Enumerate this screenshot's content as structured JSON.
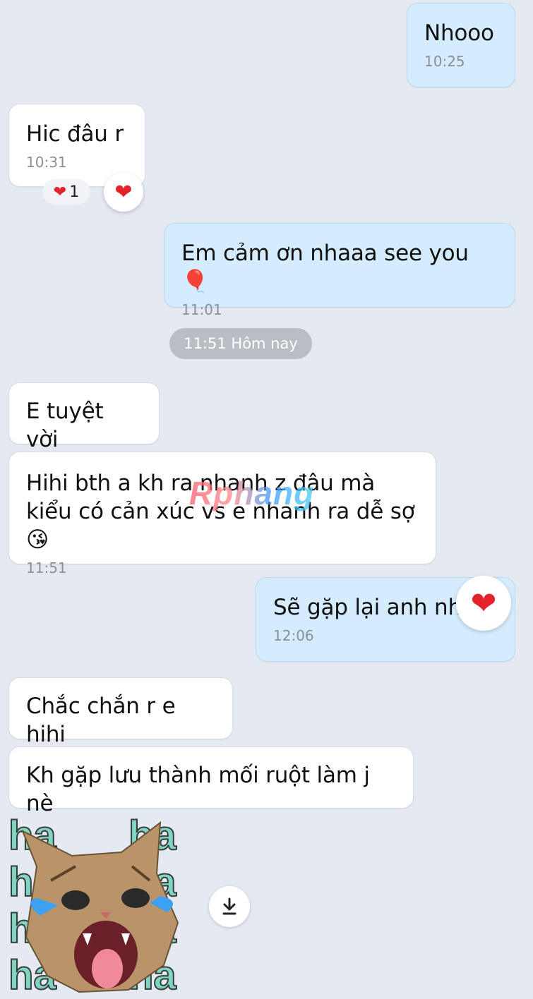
{
  "messages": [
    {
      "text": "Nhooo",
      "time": "10:25"
    },
    {
      "text": "Hic đâu r",
      "time": "10:31",
      "reaction_count": "1"
    },
    {
      "text": "Em cảm ơn nhaaa see you 🎈",
      "time": "11:01"
    },
    {
      "text": "E tuyệt vời"
    },
    {
      "text": "Hihi bth a kh ra nhanh z đâu mà kiểu có cản xúc vs e nhanh ra dễ sợ😘",
      "time": "11:51"
    },
    {
      "text": "Sẽ gặp lại anh nhé",
      "time": "12:06"
    },
    {
      "text": "Chắc chắn r e hihi"
    },
    {
      "text": "Kh gặp lưu thành mối ruột làm j nè"
    }
  ],
  "separator": {
    "text": "11:51 Hôm nay"
  },
  "reactions": {
    "heart": "❤",
    "count_1": "1"
  },
  "watermark": {
    "text": "Rphang"
  },
  "sticker": {
    "word": "ha",
    "icon": "laughing-cat-sticker"
  },
  "icons": {
    "download": "download-icon",
    "heart": "heart-icon"
  },
  "colors": {
    "background": "#e5e9f2",
    "incoming": "#ffffff",
    "outgoing": "#d4ecfd",
    "heart": "#e3222c"
  }
}
